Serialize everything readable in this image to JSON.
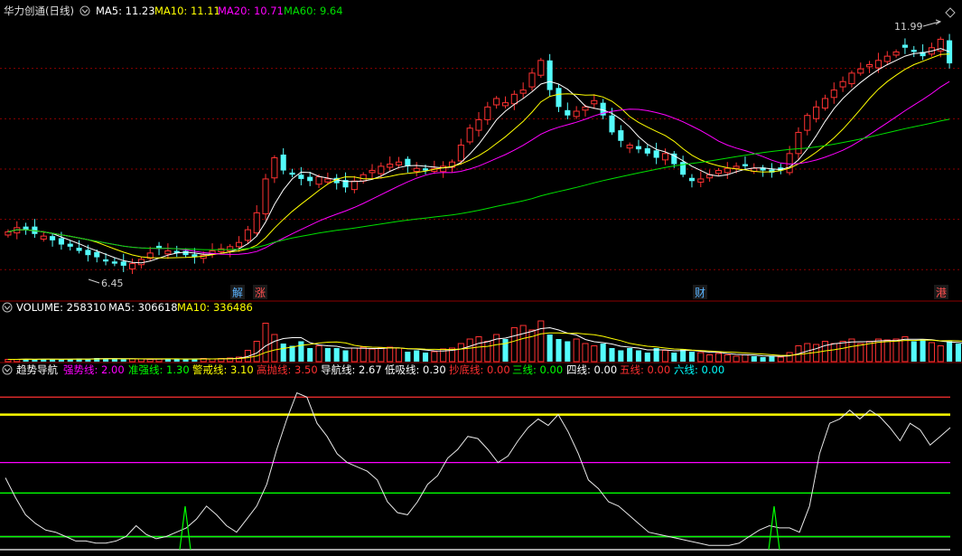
{
  "title": "华力创通(日线)",
  "price_panel": {
    "legend": [
      {
        "label": "MA5: 11.23",
        "color": "#ffffff"
      },
      {
        "label": "MA10: 11.11",
        "color": "#ffff00"
      },
      {
        "label": "MA20: 10.71",
        "color": "#ff00ff"
      },
      {
        "label": "MA60: 9.64",
        "color": "#00e000"
      }
    ],
    "high_label": "11.99",
    "low_label": "6.45",
    "markers": [
      "解",
      "涨",
      "财",
      "港"
    ]
  },
  "volume_panel": {
    "legend": [
      {
        "label": "VOLUME: 258310",
        "color": "#ffffff"
      },
      {
        "label": "MA5: 306618",
        "color": "#ffffff"
      },
      {
        "label": "MA10: 336486",
        "color": "#ffff00"
      }
    ]
  },
  "indicator_panel": {
    "name": "趋势导航",
    "legend": [
      {
        "label": "强势线: 2.00",
        "color": "#ff00ff"
      },
      {
        "label": "准强线: 1.30",
        "color": "#00ff00"
      },
      {
        "label": "警戒线: 3.10",
        "color": "#ffff00"
      },
      {
        "label": "高抛线: 3.50",
        "color": "#ff3030"
      },
      {
        "label": "导航线: 2.67",
        "color": "#ffffff"
      },
      {
        "label": "低吸线: 0.30",
        "color": "#ffffff"
      },
      {
        "label": "抄底线: 0.00",
        "color": "#ff3030"
      },
      {
        "label": "三线: 0.00",
        "color": "#00ff00"
      },
      {
        "label": "四线: 0.00",
        "color": "#ffffff"
      },
      {
        "label": "五线: 0.00",
        "color": "#ff3030"
      },
      {
        "label": "六线: 0.00",
        "color": "#00ffff"
      }
    ]
  },
  "colors": {
    "up": "#ff3232",
    "down": "#54fcfc",
    "ma5": "#ffffff",
    "ma10": "#ffff00",
    "ma20": "#ff00ff",
    "ma60": "#00e000",
    "grid": "#8b0000"
  },
  "chart_data": [
    {
      "type": "candlestick",
      "ylim": [
        6.0,
        12.3
      ],
      "high": 11.99,
      "low": 6.45,
      "close_path": [
        7.25,
        7.35,
        7.3,
        7.2,
        7.15,
        7.05,
        6.95,
        6.9,
        6.8,
        6.7,
        6.65,
        6.55,
        6.5,
        6.45,
        6.5,
        6.6,
        6.75,
        6.85,
        6.8,
        6.75,
        6.7,
        6.65,
        6.7,
        6.8,
        6.85,
        6.9,
        7.0,
        7.3,
        7.7,
        8.5,
        9.0,
        8.7,
        8.6,
        8.5,
        8.45,
        8.55,
        8.5,
        8.4,
        8.3,
        8.45,
        8.6,
        8.7,
        8.8,
        8.85,
        8.9,
        8.8,
        8.75,
        8.7,
        8.75,
        8.8,
        8.9,
        9.3,
        9.7,
        9.9,
        10.2,
        10.4,
        10.3,
        10.5,
        10.6,
        11.0,
        11.3,
        10.6,
        10.2,
        10.0,
        10.1,
        10.2,
        10.35,
        10.0,
        9.6,
        9.4,
        9.3,
        9.2,
        9.1,
        9.0,
        9.1,
        8.85,
        8.6,
        8.45,
        8.5,
        8.6,
        8.7,
        8.75,
        8.8,
        8.8,
        8.75,
        8.7,
        8.65,
        8.7,
        9.1,
        9.6,
        10.0,
        10.2,
        10.4,
        10.6,
        10.8,
        11.0,
        11.1,
        11.2,
        11.3,
        11.4,
        11.5,
        11.6,
        11.5,
        11.4,
        11.6,
        11.8,
        11.23
      ]
    },
    {
      "type": "bar",
      "name": "VOLUME",
      "series_level": [
        0.05,
        0.05,
        0.06,
        0.05,
        0.06,
        0.05,
        0.05,
        0.06,
        0.07,
        0.06,
        0.08,
        0.07,
        0.06,
        0.05,
        0.06,
        0.06,
        0.05,
        0.06,
        0.07,
        0.06,
        0.05,
        0.06,
        0.07,
        0.06,
        0.07,
        0.08,
        0.1,
        0.25,
        0.45,
        0.85,
        0.6,
        0.4,
        0.35,
        0.45,
        0.3,
        0.35,
        0.3,
        0.3,
        0.25,
        0.3,
        0.32,
        0.28,
        0.3,
        0.32,
        0.3,
        0.22,
        0.25,
        0.2,
        0.22,
        0.28,
        0.3,
        0.4,
        0.5,
        0.55,
        0.45,
        0.6,
        0.5,
        0.75,
        0.8,
        0.7,
        0.9,
        0.6,
        0.5,
        0.45,
        0.5,
        0.4,
        0.35,
        0.4,
        0.3,
        0.25,
        0.3,
        0.25,
        0.2,
        0.3,
        0.25,
        0.2,
        0.28,
        0.22,
        0.2,
        0.15,
        0.18,
        0.15,
        0.12,
        0.15,
        0.12,
        0.1,
        0.12,
        0.1,
        0.2,
        0.35,
        0.4,
        0.38,
        0.45,
        0.4,
        0.45,
        0.5,
        0.4,
        0.45,
        0.5,
        0.48,
        0.5,
        0.55,
        0.45,
        0.5,
        0.42,
        0.35,
        0.45,
        0.4,
        0.35
      ]
    },
    {
      "type": "line",
      "name": "趋势导航",
      "ylim": [
        0,
        3.9
      ],
      "reference_lines": [
        {
          "value": 0.0,
          "color": "#ffffff"
        },
        {
          "value": 0.3,
          "color": "#ffffff"
        },
        {
          "value": 0.3,
          "color": "#00ff00"
        },
        {
          "value": 1.3,
          "color": "#00ff00"
        },
        {
          "value": 2.0,
          "color": "#ff00ff"
        },
        {
          "value": 3.1,
          "color": "#ffff00"
        },
        {
          "value": 3.5,
          "color": "#ff3030"
        }
      ],
      "nav_values": [
        1.65,
        1.2,
        0.8,
        0.6,
        0.45,
        0.4,
        0.3,
        0.2,
        0.2,
        0.15,
        0.15,
        0.2,
        0.3,
        0.55,
        0.35,
        0.25,
        0.3,
        0.4,
        0.5,
        0.7,
        1.0,
        0.8,
        0.55,
        0.4,
        0.7,
        1.0,
        1.5,
        2.3,
        3.0,
        3.6,
        3.5,
        2.9,
        2.6,
        2.2,
        2.0,
        1.9,
        1.8,
        1.6,
        1.1,
        0.85,
        0.8,
        1.1,
        1.5,
        1.7,
        2.1,
        2.3,
        2.6,
        2.55,
        2.3,
        2.0,
        2.15,
        2.5,
        2.8,
        3.0,
        2.85,
        3.1,
        2.7,
        2.2,
        1.6,
        1.4,
        1.1,
        1.0,
        0.8,
        0.6,
        0.4,
        0.35,
        0.3,
        0.25,
        0.2,
        0.15,
        0.1,
        0.1,
        0.1,
        0.15,
        0.3,
        0.45,
        0.55,
        0.5,
        0.5,
        0.4,
        1.0,
        2.2,
        2.9,
        3.0,
        3.2,
        3.0,
        3.2,
        3.05,
        2.8,
        2.5,
        2.9,
        2.75,
        2.4,
        2.6,
        2.8
      ]
    }
  ]
}
